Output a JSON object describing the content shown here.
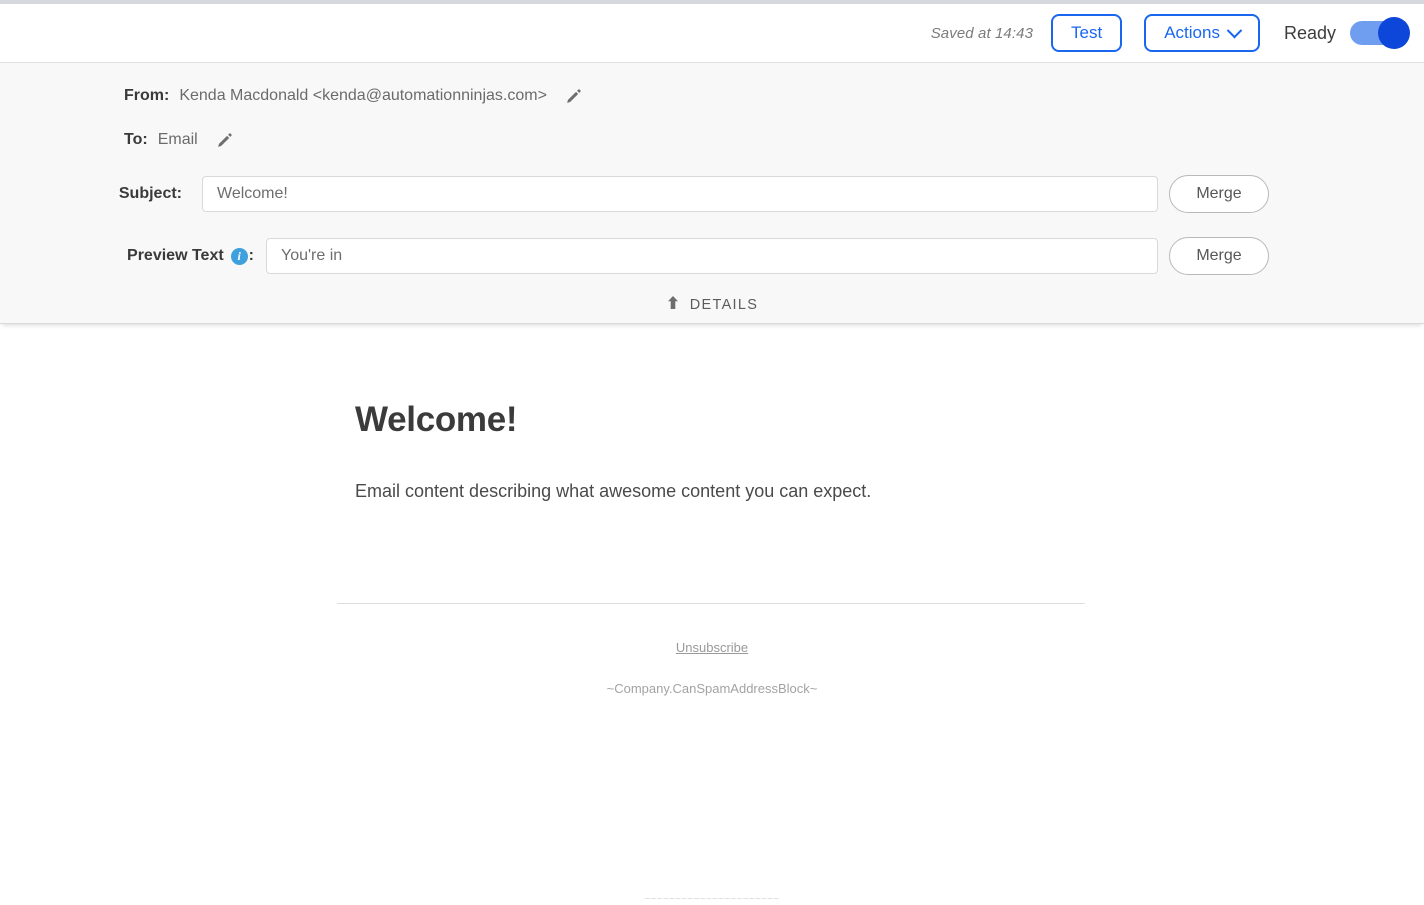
{
  "toolbar": {
    "saved_label": "Saved at 14:43",
    "test_label": "Test",
    "actions_label": "Actions",
    "ready_label": "Ready",
    "toggle_state": "on",
    "accent_color": "#1967f0",
    "toggle_knob_color": "#0d47d9",
    "toggle_track_color": "#6f9ef0"
  },
  "details": {
    "from_label": "From:",
    "from_value": "Kenda Macdonald <kenda@automationninjas.com>",
    "to_label": "To:",
    "to_value": "Email",
    "subject_label": "Subject:",
    "subject_value": "Welcome!",
    "subject_placeholder": "Subject",
    "preview_label": "Preview Text",
    "preview_colon": ":",
    "preview_value": "You're in",
    "preview_placeholder": "Preview Text",
    "info_glyph": "i",
    "merge_label": "Merge",
    "details_toggle_label": "DETAILS",
    "info_icon_color": "#3ea0dd"
  },
  "email": {
    "heading": "Welcome!",
    "paragraph": "Email content describing what awesome content you can expect.",
    "unsubscribe_label": "Unsubscribe",
    "address_block": "~Company.CanSpamAddressBlock~",
    "bottom_code": "~~~~~~~~~~~~~~~~~~~~~~"
  }
}
